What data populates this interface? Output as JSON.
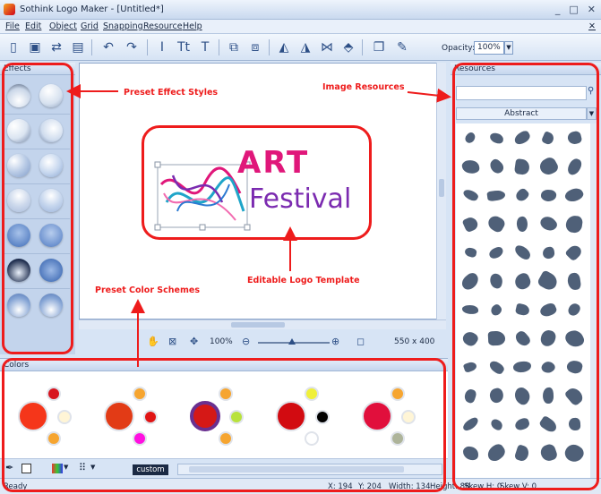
{
  "window": {
    "title": "Sothink Logo Maker - [Untitled*]",
    "min": "_",
    "max": "□",
    "close": "✕"
  },
  "menu": [
    "File",
    "Edit",
    "Object",
    "Grid",
    "Snapping",
    "Resource",
    "Help"
  ],
  "menu_close": "✕",
  "toolbar": {
    "opacity_label": "Opacity:",
    "opacity_value": "100%"
  },
  "effects": {
    "title": "Effects"
  },
  "canvas": {
    "logo_line1": "ART",
    "logo_line2": "Festival"
  },
  "zoom": {
    "percent": "100%",
    "canvas_size": "550 x 400"
  },
  "colors": {
    "title": "Colors",
    "custom_label": "custom",
    "schemes": [
      {
        "main": "#f5361a",
        "dots": [
          "#d7141e",
          "#fff5d6",
          "#f6a530",
          "#f6a530"
        ]
      },
      {
        "main": "#e23b16",
        "dots": [
          "#f6a530",
          "#e01414",
          "#ff10e0",
          "#f6a530"
        ]
      },
      {
        "main": "#d51816",
        "ring": "#6a3090",
        "dots": [
          "#f6a530",
          "#b8e23c",
          "#f6a530",
          "#f6a530"
        ]
      },
      {
        "main": "#d20b11",
        "dots": [
          "#f0f03a",
          "#000000",
          "#ffffff",
          "#f6a530"
        ]
      },
      {
        "main": "#e10f3c",
        "dots": [
          "#f6a530",
          "#fff5d6",
          "#aeb49a",
          "#f6a530"
        ]
      }
    ]
  },
  "resources": {
    "title": "Resources",
    "category": "Abstract",
    "search_placeholder": ""
  },
  "status": {
    "ready": "Ready",
    "x": "X: 194",
    "y": "Y: 204",
    "width": "Width: 134",
    "height": "Height: 88",
    "skewh": "Skew H: 0",
    "skewv": "Skew V: 0"
  },
  "annotations": {
    "effects": "Preset Effect Styles",
    "resources": "Image Resources",
    "template": "Editable Logo Template",
    "colors": "Preset Color Schemes"
  }
}
